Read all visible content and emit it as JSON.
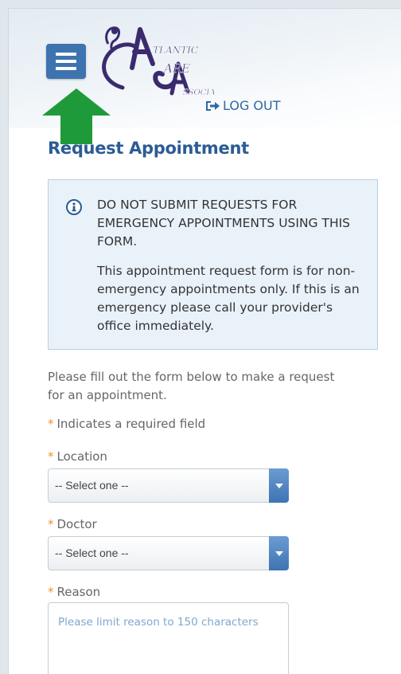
{
  "header": {
    "logo_text": "Atlantic Care Associates",
    "logout_label": "LOG OUT",
    "logout_icon": "sign-out-icon",
    "menu_icon": "hamburger-menu-icon"
  },
  "page": {
    "title": "Request Appointment"
  },
  "alert": {
    "icon": "info-circle-icon",
    "heading": "DO NOT SUBMIT REQUESTS FOR EMERGENCY APPOINTMENTS USING THIS FORM.",
    "body": "This appointment request form is for non-emergency appointments only. If this is an emergency please call your provider's office immediately."
  },
  "form": {
    "intro": "Please fill out the form below to make a request for an appointment.",
    "required_note": "Indicates a required field",
    "required_marker": "*",
    "location": {
      "label": "Location",
      "selected": "-- Select one --"
    },
    "doctor": {
      "label": "Doctor",
      "selected": "-- Select one --"
    },
    "reason": {
      "label": "Reason",
      "placeholder": "Please limit reason to 150 characters"
    }
  },
  "colors": {
    "accent": "#3d74b0",
    "title": "#2b5c94",
    "required_star": "#e8952b",
    "arrow": "#1f9a3a",
    "alert_bg": "#eaf2f9"
  }
}
